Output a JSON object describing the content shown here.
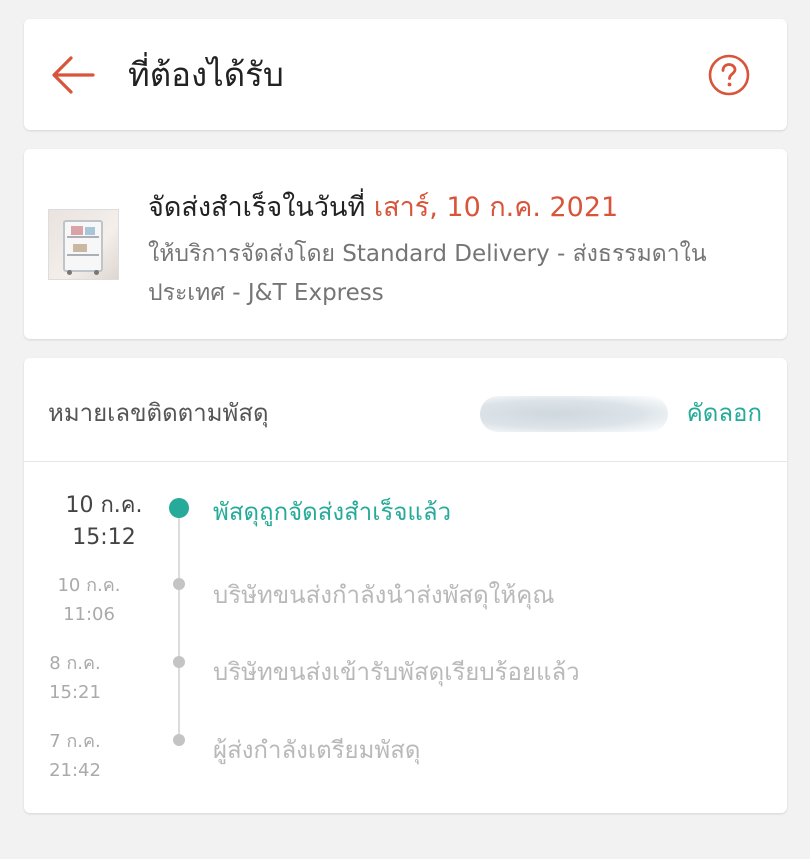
{
  "header": {
    "title": "ที่ต้องได้รับ",
    "back_icon": "arrow-left-icon",
    "help_icon": "question-circle-icon",
    "accent_color": "#d8543a"
  },
  "delivery": {
    "status_text": "จัดส่งสำเร็จในวันที่",
    "status_date": "เสาร์, 10 ก.ค. 2021",
    "service_text": "ให้บริการจัดส่งโดย Standard Delivery - ส่งธรรมดาในประเทศ - J&T Express"
  },
  "tracking": {
    "label": "หมายเลขติดตามพัสดุ",
    "number": "",
    "copy_label": "คัดลอก",
    "accent_color": "#26aa99",
    "events": [
      {
        "date": "10 ก.ค.",
        "time": "15:12",
        "text": "พัสดุถูกจัดส่งสำเร็จแล้ว",
        "active": true
      },
      {
        "date": "10 ก.ค.",
        "time": "11:06",
        "text": "บริษัทขนส่งกำลังนำส่งพัสดุให้คุณ",
        "active": false
      },
      {
        "date": "8 ก.ค.",
        "time": "15:21",
        "text": "บริษัทขนส่งเข้ารับพัสดุเรียบร้อยแล้ว",
        "active": false
      },
      {
        "date": "7 ก.ค.",
        "time": "21:42",
        "text": "ผู้ส่งกำลังเตรียมพัสดุ",
        "active": false
      }
    ]
  }
}
